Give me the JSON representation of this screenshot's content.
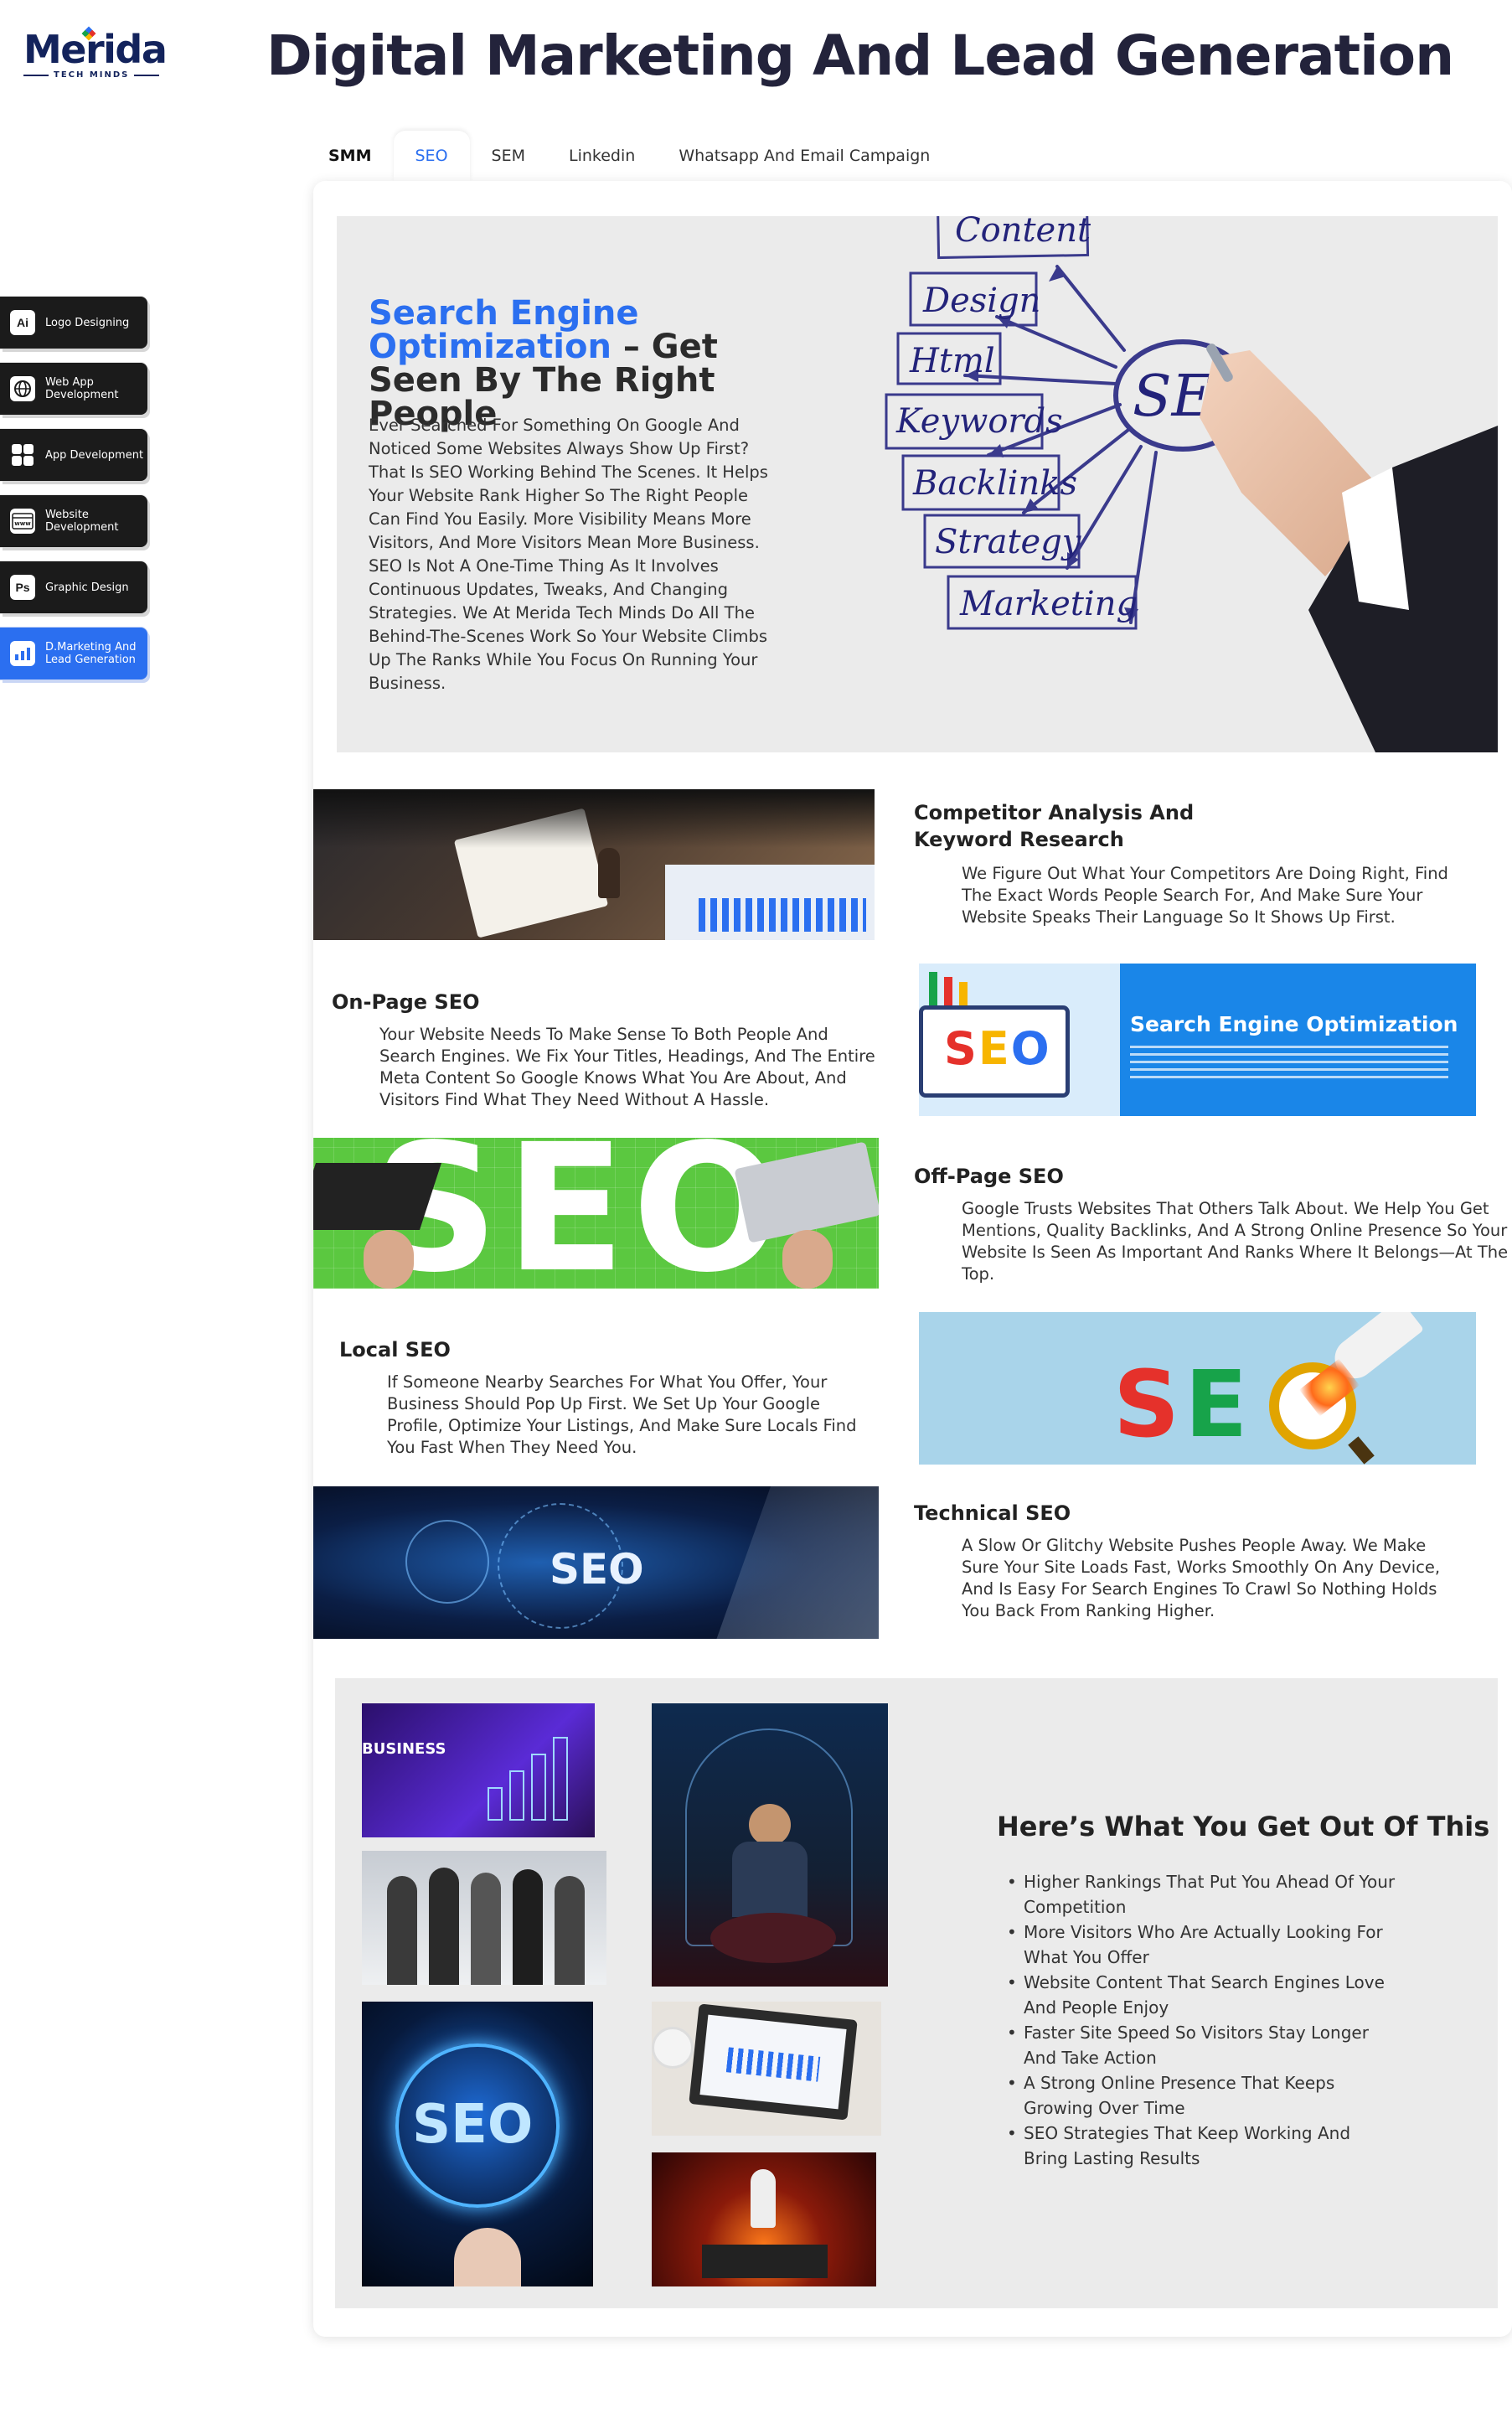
{
  "brand": {
    "name": "Merida",
    "tagline": "TECH MINDS"
  },
  "page_title": "Digital Marketing And Lead Generation",
  "tabs": [
    {
      "label": "SMM",
      "active": false
    },
    {
      "label": "SEO",
      "active": true
    },
    {
      "label": "SEM",
      "active": false
    },
    {
      "label": "Linkedin",
      "active": false
    },
    {
      "label": "Whatsapp And Email Campaign",
      "active": false
    }
  ],
  "sidebar": {
    "items": [
      {
        "icon": "Ai",
        "label": "Logo Designing",
        "active": false
      },
      {
        "icon": "globe",
        "label": "Web App Development",
        "active": false
      },
      {
        "icon": "grid",
        "label": "App Development",
        "active": false
      },
      {
        "icon": "www",
        "label": "Website Development",
        "active": false
      },
      {
        "icon": "Ps",
        "label": "Graphic Design",
        "active": false
      },
      {
        "icon": "chart",
        "label": "D.Marketing And Lead Generation",
        "active": true
      }
    ]
  },
  "hero": {
    "title_highlight": "Search Engine Optimization",
    "title_rest": " – Get Seen By The Right People",
    "body": "Ever Searched For Something On Google And Noticed Some Websites Always Show Up First? That Is SEO Working Behind The Scenes. It Helps Your Website Rank Higher So The Right People Can Find You Easily. More Visibility Means More Visitors, And More Visitors Mean More Business. SEO Is Not A One-Time Thing As It Involves Continuous Updates, Tweaks, And Changing Strategies. We At Merida Tech Minds Do All The Behind-The-Scenes Work So Your Website Climbs Up The Ranks While You Focus On Running Your Business.",
    "diagram": {
      "center": "SEO",
      "words": [
        "Content",
        "Design",
        "Html",
        "Keywords",
        "Backlinks",
        "Strategy",
        "Marketing"
      ]
    }
  },
  "features": [
    {
      "title": "Competitor Analysis And Keyword Research",
      "text": "We Figure Out What Your Competitors Are Doing Right, Find The Exact Words People Search For, And Make Sure Your Website Speaks Their Language So It Shows Up First."
    },
    {
      "title": "On-Page SEO",
      "text": "Your Website Needs To Make Sense To Both People And Search Engines. We Fix Your Titles, Headings, And The Entire Meta Content So Google Knows What You Are About, And Visitors Find What They Need Without A Hassle."
    },
    {
      "title": "Off-Page SEO",
      "text": "Google Trusts Websites That Others Talk About. We Help You Get Mentions, Quality Backlinks, And A Strong Online Presence So Your Website Is Seen As Important And Ranks Where It Belongs—At The Top."
    },
    {
      "title": "Local SEO",
      "text": "If Someone Nearby Searches For What You Offer, Your Business Should Pop Up First. We Set Up Your Google Profile, Optimize Your Listings, And Make Sure Locals Find You Fast When They Need You."
    },
    {
      "title": "Technical SEO",
      "text": "A Slow Or Glitchy Website Pushes People Away. We Make Sure Your Site Loads Fast, Works Smoothly On Any Device, And Is Easy For Search Engines To Crawl So Nothing Holds You Back From Ranking Higher."
    }
  ],
  "image_text": {
    "seo_banner_title": "Search Engine Optimization",
    "seo_banner_logo": "SEO",
    "green_seo": "SEO",
    "rocket_seo": "SEO",
    "tech_seo": "SEO",
    "business": "BUSINESS",
    "glow_seo": "SEO"
  },
  "benefits": {
    "title": "Here’s What You Get Out Of This",
    "items": [
      "Higher Rankings That Put You Ahead Of Your Competition",
      "More Visitors Who Are Actually Looking For What You Offer",
      "Website Content That Search Engines Love And People Enjoy",
      "Faster Site Speed So Visitors Stay Longer And Take Action",
      "A Strong Online Presence That Keeps Growing Over Time",
      "SEO Strategies That Keep Working And Bring Lasting Results"
    ]
  },
  "colors": {
    "accent": "#2b6ff0",
    "dark": "#1b1b1b",
    "heading": "#23233b",
    "panel": "#ebebeb"
  }
}
